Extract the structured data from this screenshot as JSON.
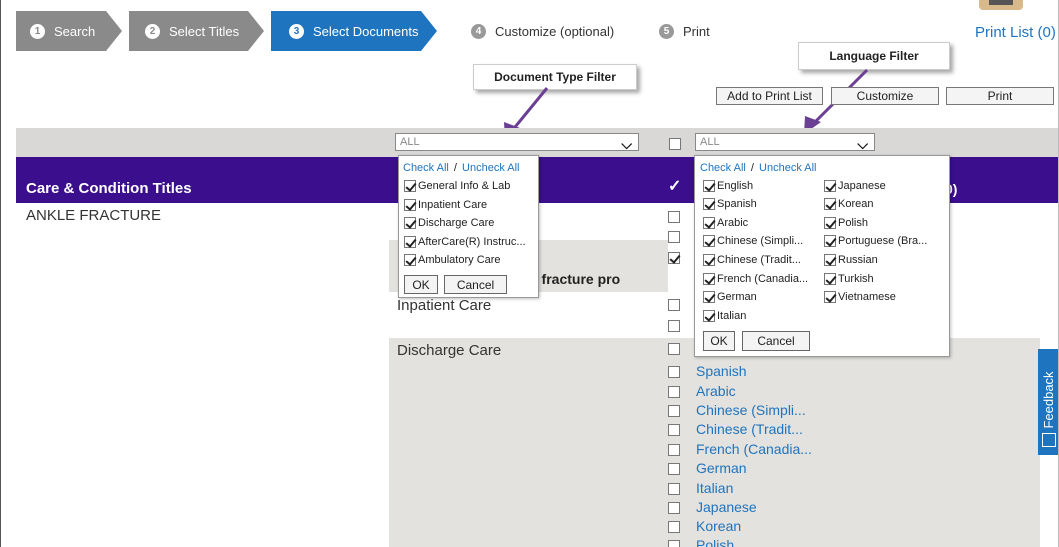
{
  "wizard": {
    "steps": [
      {
        "num": "1",
        "label": "Search"
      },
      {
        "num": "2",
        "label": "Select Titles"
      },
      {
        "num": "3",
        "label": "Select Documents"
      },
      {
        "num": "4",
        "label": "Customize (optional)"
      },
      {
        "num": "5",
        "label": "Print"
      }
    ]
  },
  "print_list": {
    "label": "Print List (0)"
  },
  "callouts": {
    "doc_type": "Document Type Filter",
    "language": "Language Filter"
  },
  "toolbar": {
    "add": "Add to Print List",
    "customize": "Customize",
    "print": "Print"
  },
  "filters": {
    "doc_type_value": "ALL",
    "language_value": "ALL"
  },
  "table": {
    "header": "Care & Condition Titles",
    "header_right": "0)",
    "title": "ANKLE FRACTURE",
    "section_heading_partial": "und fracture pro",
    "rows": [
      "Inpatient Care",
      "Discharge Care"
    ]
  },
  "doc_type_dropdown": {
    "check_all": "Check All",
    "sep": " / ",
    "uncheck_all": "Uncheck All",
    "items": [
      "General Info & Lab",
      "Inpatient Care",
      "Discharge Care",
      "AfterCare(R) Instruc...",
      "Ambulatory Care"
    ],
    "ok": "OK",
    "cancel": "Cancel"
  },
  "language_dropdown": {
    "check_all": "Check All",
    "sep": " / ",
    "uncheck_all": "Uncheck All",
    "col1": [
      "English",
      "Spanish",
      "Arabic",
      "Chinese (Simpli...",
      "Chinese (Tradit...",
      "French (Canadia...",
      "German",
      "Italian"
    ],
    "col2": [
      "Japanese",
      "Korean",
      "Polish",
      "Portuguese (Bra...",
      "Russian",
      "Turkish",
      "Vietnamese"
    ],
    "ok": "OK",
    "cancel": "Cancel"
  },
  "language_list": [
    "Spanish",
    "Arabic",
    "Chinese (Simpli...",
    "Chinese (Tradit...",
    "French (Canadia...",
    "German",
    "Italian",
    "Japanese",
    "Korean",
    "Polish"
  ],
  "feedback": {
    "label": "Feedback"
  }
}
